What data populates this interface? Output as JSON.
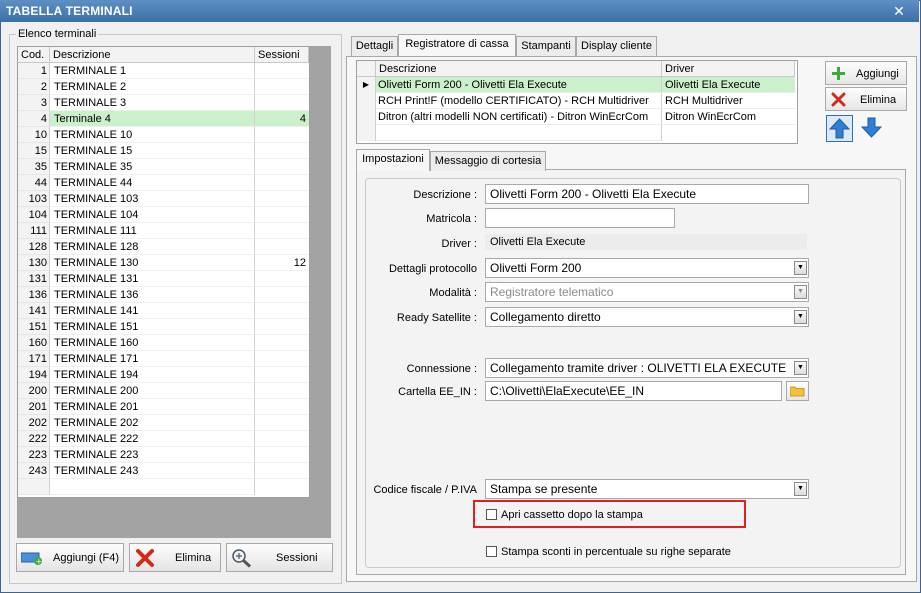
{
  "window": {
    "title": "TABELLA TERMINALI",
    "close_glyph": "✕"
  },
  "terminal_list": {
    "group_label": "Elenco terminali",
    "columns": [
      "Cod.",
      "Descrizione",
      "Sessioni"
    ],
    "rows": [
      {
        "code": "1",
        "desc": "TERMINALE 1",
        "sessions": ""
      },
      {
        "code": "2",
        "desc": "TERMINALE 2",
        "sessions": ""
      },
      {
        "code": "3",
        "desc": "TERMINALE 3",
        "sessions": ""
      },
      {
        "code": "4",
        "desc": "Terminale 4",
        "sessions": "4"
      },
      {
        "code": "10",
        "desc": "TERMINALE 10",
        "sessions": ""
      },
      {
        "code": "15",
        "desc": "TERMINALE 15",
        "sessions": ""
      },
      {
        "code": "35",
        "desc": "TERMINALE 35",
        "sessions": ""
      },
      {
        "code": "44",
        "desc": "TERMINALE 44",
        "sessions": ""
      },
      {
        "code": "103",
        "desc": "TERMINALE 103",
        "sessions": ""
      },
      {
        "code": "104",
        "desc": "TERMINALE 104",
        "sessions": ""
      },
      {
        "code": "111",
        "desc": "TERMINALE 111",
        "sessions": ""
      },
      {
        "code": "128",
        "desc": "TERMINALE 128",
        "sessions": ""
      },
      {
        "code": "130",
        "desc": "TERMINALE 130",
        "sessions": "12"
      },
      {
        "code": "131",
        "desc": "TERMINALE 131",
        "sessions": ""
      },
      {
        "code": "136",
        "desc": "TERMINALE 136",
        "sessions": ""
      },
      {
        "code": "141",
        "desc": "TERMINALE 141",
        "sessions": ""
      },
      {
        "code": "151",
        "desc": "TERMINALE 151",
        "sessions": ""
      },
      {
        "code": "160",
        "desc": "TERMINALE 160",
        "sessions": ""
      },
      {
        "code": "171",
        "desc": "TERMINALE 171",
        "sessions": ""
      },
      {
        "code": "194",
        "desc": "TERMINALE 194",
        "sessions": ""
      },
      {
        "code": "200",
        "desc": "TERMINALE 200",
        "sessions": ""
      },
      {
        "code": "201",
        "desc": "TERMINALE 201",
        "sessions": ""
      },
      {
        "code": "202",
        "desc": "TERMINALE 202",
        "sessions": ""
      },
      {
        "code": "222",
        "desc": "TERMINALE 222",
        "sessions": ""
      },
      {
        "code": "223",
        "desc": "TERMINALE 223",
        "sessions": ""
      },
      {
        "code": "243",
        "desc": "TERMINALE 243",
        "sessions": ""
      }
    ],
    "selected_code": "4"
  },
  "bottom_buttons": {
    "add": "Aggiungi (F4)",
    "delete": "Elimina",
    "sessions": "Sessioni"
  },
  "main_tabs": [
    "Dettagli",
    "Registratore di cassa",
    "Stampanti",
    "Display cliente"
  ],
  "main_tab_active": "Registratore di cassa",
  "drivers": {
    "columns": [
      "Descrizione",
      "Driver"
    ],
    "rows": [
      {
        "desc": "Olivetti Form 200 - Olivetti Ela Execute",
        "driver": "Olivetti Ela Execute"
      },
      {
        "desc": "RCH Print!F (modello CERTIFICATO) - RCH Multidriver",
        "driver": "RCH Multidriver"
      },
      {
        "desc": "Ditron (altri modelli NON certificati) - Ditron WinEcrCom",
        "driver": "Ditron WinEcrCom"
      }
    ],
    "current_row_marker": "▶"
  },
  "side_buttons": {
    "add": "Aggiungi",
    "delete": "Elimina"
  },
  "sub_tabs": [
    "Impostazioni",
    "Messaggio di cortesia"
  ],
  "form": {
    "descrizione_label": "Descrizione :",
    "descrizione_value": "Olivetti Form 200 - Olivetti Ela Execute",
    "matricola_label": "Matricola :",
    "matricola_value": "",
    "driver_label": "Driver :",
    "driver_value": "Olivetti Ela Execute",
    "protocollo_label": "Dettagli protocollo",
    "protocollo_value": "Olivetti Form 200",
    "modalita_label": "Modalità :",
    "modalita_value": "Registratore telematico",
    "satellite_label": "Ready Satellite :",
    "satellite_value": "Collegamento diretto",
    "connessione_label": "Connessione :",
    "connessione_value": "Collegamento tramite driver : OLIVETTI ELA EXECUTE",
    "cartella_label": "Cartella EE_IN :",
    "cartella_value": "C:\\Olivetti\\ElaExecute\\EE_IN",
    "codice_label": "Codice fiscale / P.IVA",
    "codice_value": "Stampa se presente",
    "apri_cassetto_label": "Apri cassetto dopo la stampa",
    "sconti_label": "Stampa sconti in percentuale su righe separate"
  },
  "colors": {
    "title_bar": "#4a7db5",
    "selection": "#ccf0cc",
    "highlight_box": "#e0201c",
    "arrow_blue": "#2e7fd6"
  }
}
